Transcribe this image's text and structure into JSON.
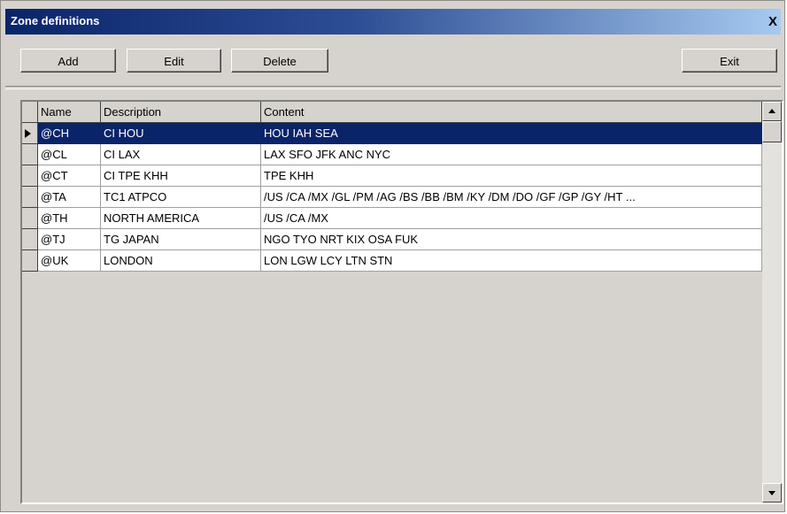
{
  "window": {
    "title": "Zone definitions",
    "close_label": "X"
  },
  "toolbar": {
    "add_label": "Add",
    "edit_label": "Edit",
    "delete_label": "Delete",
    "exit_label": "Exit"
  },
  "grid": {
    "columns": [
      "Name",
      "Description",
      "Content"
    ],
    "rows": [
      {
        "name": "@CH",
        "description": "CI HOU",
        "content": "HOU IAH SEA",
        "selected": true
      },
      {
        "name": "@CL",
        "description": "CI LAX",
        "content": "LAX SFO JFK ANC NYC"
      },
      {
        "name": "@CT",
        "description": "CI TPE KHH",
        "content": "TPE KHH"
      },
      {
        "name": "@TA",
        "description": "TC1 ATPCO",
        "content": "/US /CA /MX /GL /PM /AG /BS /BB /BM /KY /DM /DO /GF /GP /GY /HT ..."
      },
      {
        "name": "@TH",
        "description": "NORTH AMERICA",
        "content": "/US /CA /MX"
      },
      {
        "name": "@TJ",
        "description": "TG JAPAN",
        "content": "NGO TYO NRT KIX OSA FUK"
      },
      {
        "name": "@UK",
        "description": "LONDON",
        "content": "LON LGW LCY LTN STN"
      }
    ]
  },
  "icons": {
    "row_indicator": "triangle-right-icon",
    "scroll_up": "arrow-up-icon",
    "scroll_down": "arrow-down-icon"
  },
  "colors": {
    "title_start": "#0a246a",
    "title_end": "#a6caf0",
    "selection": "#0a246a",
    "face": "#d6d3ce"
  }
}
